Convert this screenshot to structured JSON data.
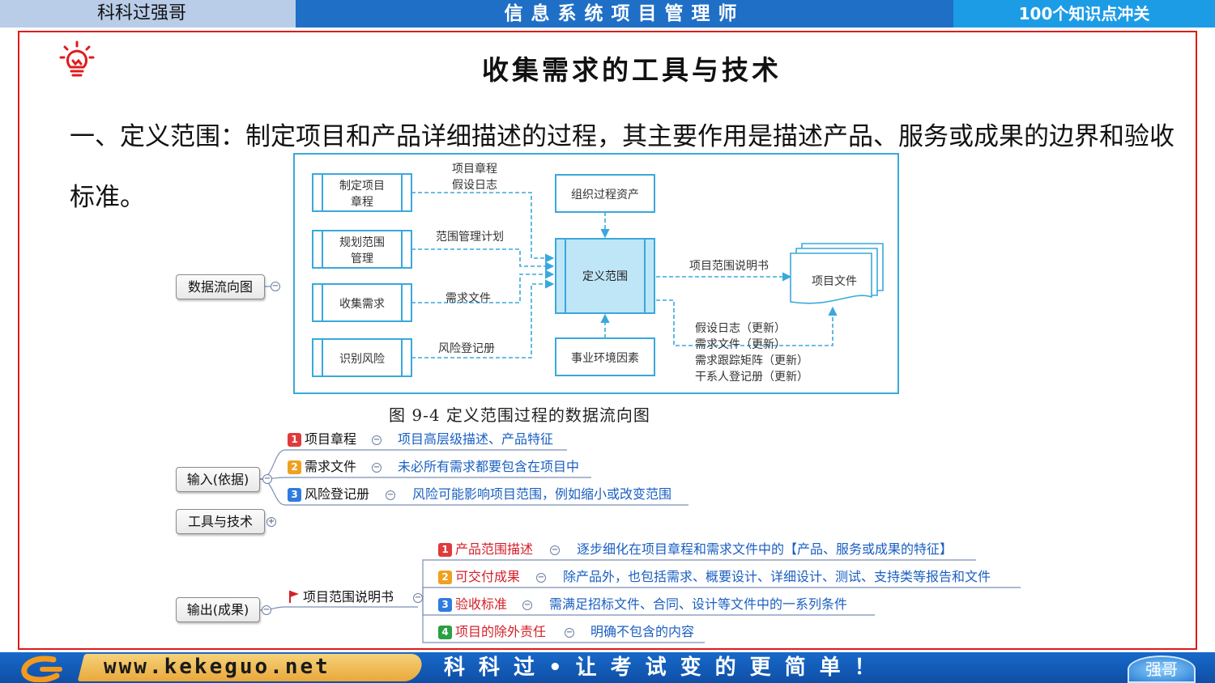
{
  "header": {
    "left_label": "科科过强哥",
    "center_title": "信息系统项目管理师",
    "right_label": "100个知识点冲关"
  },
  "page_title": "收集需求的工具与技术",
  "intro_text": "一、定义范围：制定项目和产品详细描述的过程，其主要作用是描述产品、服务或成果的边界和验收标准。",
  "diagram": {
    "inputs": [
      "制定项目\n章程",
      "规划范围\n管理",
      "收集需求",
      "识别风险"
    ],
    "input_line1": [
      "制定项目",
      "规划范围",
      "收集需求",
      "识别风险"
    ],
    "input_line2": [
      "章程",
      "管理",
      "",
      ""
    ],
    "flow_labels": [
      "项目章程",
      "假设日志",
      "范围管理计划",
      "需求文件",
      "风险登记册"
    ],
    "top_box": "组织过程资产",
    "center_box": "定义范围",
    "bottom_box": "事业环境因素",
    "output_label": "项目范围说明书",
    "output_doc": "项目文件",
    "updates": [
      "假设日志（更新）",
      "需求文件（更新）",
      "需求跟踪矩阵（更新）",
      "干系人登记册（更新）"
    ],
    "caption": "图 9-4  定义范围过程的数据流向图"
  },
  "mindmap": {
    "dataflow_node": "数据流向图",
    "inputs_node": "输入(依据)",
    "tools_node": "工具与技术",
    "outputs_node": "输出(成果)",
    "inputs": [
      {
        "num": "1",
        "color": "#e03a3a",
        "label": "项目章程",
        "desc": "项目高层级描述、产品特征"
      },
      {
        "num": "2",
        "color": "#f0a020",
        "label": "需求文件",
        "desc": "未必所有需求都要包含在项目中"
      },
      {
        "num": "3",
        "color": "#2f7be0",
        "label": "风险登记册",
        "desc": "风险可能影响项目范围，例如缩小或改变范围"
      }
    ],
    "output_main": "项目范围说明书",
    "outputs": [
      {
        "num": "1",
        "color": "#e03a3a",
        "label": "产品范围描述",
        "desc": "逐步细化在项目章程和需求文件中的【产品、服务或成果的特征】"
      },
      {
        "num": "2",
        "color": "#f0a020",
        "label": "可交付成果",
        "desc": "除产品外，也包括需求、概要设计、详细设计、测试、支持类等报告和文件"
      },
      {
        "num": "3",
        "color": "#2f7be0",
        "label": "验收标准",
        "desc": "需满足招标文件、合同、设计等文件中的一系列条件"
      },
      {
        "num": "4",
        "color": "#2aa043",
        "label": "项目的除外责任",
        "desc": "明确不包含的内容"
      }
    ]
  },
  "footer": {
    "url": "www.kekeguo.net",
    "slogan": "科科过•让考试变的更简单！",
    "avatar_label": "强哥"
  },
  "colors": {
    "header_blue": "#1f6fc6",
    "frame_red": "#e01b1b",
    "diagram_blue": "#3aa8dc",
    "desc_blue": "#1a5fc2"
  }
}
